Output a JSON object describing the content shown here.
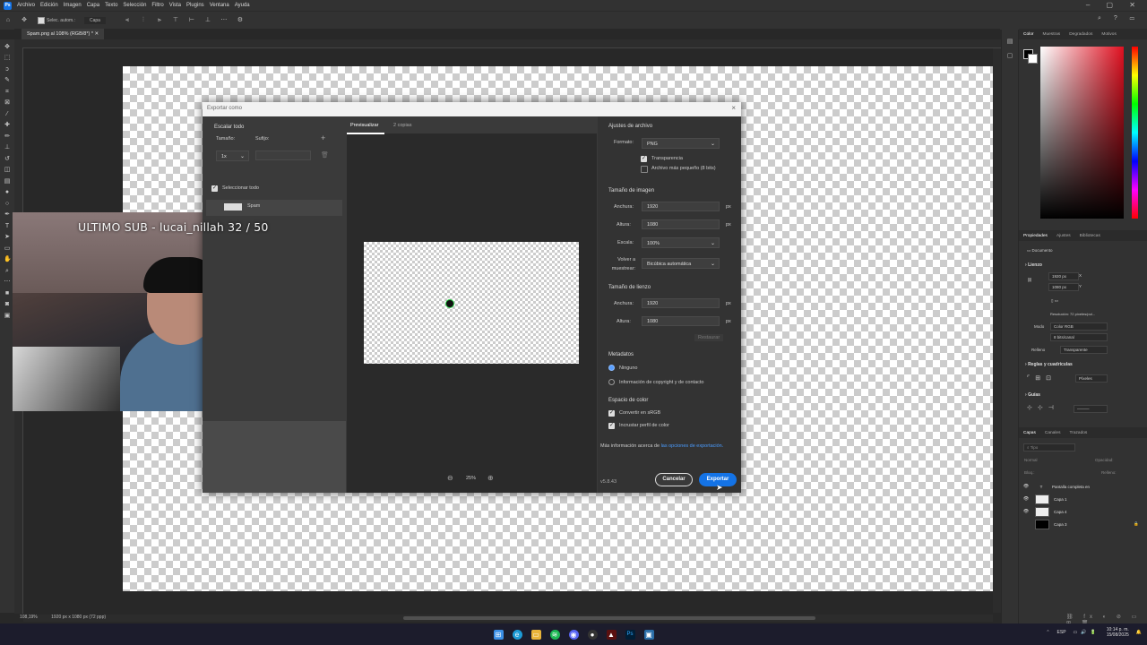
{
  "menu": [
    "Archivo",
    "Edición",
    "Imagen",
    "Capa",
    "Texto",
    "Selección",
    "Filtro",
    "Vista",
    "Plugins",
    "Ventana",
    "Ayuda"
  ],
  "options_bar": {
    "auto_select_label": "Selec. autom.:",
    "layer_select": "Capa"
  },
  "doc_tab": "Spam.png al 108% (RGB/8*) *",
  "status": {
    "zoom": "108,19%",
    "doc_info": "1920 px x 1080 px (72 ppp)"
  },
  "webcam": {
    "overlay_text": "ULTIMO SUB - lucai_nillah   32 / 50"
  },
  "dialog": {
    "title": "Exportar como",
    "left": {
      "scale_all": "Escalar todo",
      "size_label": "Tamaño:",
      "suffix_label": "Sufijo:",
      "scale_value": "1x",
      "select_all": "Seleccionar todo",
      "asset_name": "Spam"
    },
    "center": {
      "tab_preview": "Previsualizar",
      "tab_copies": "2 copias",
      "zoom": "25%"
    },
    "right": {
      "file_settings": "Ajustes de archivo",
      "format_label": "Formato:",
      "format_value": "PNG",
      "transparency": "Transparencia",
      "smaller_file": "Archivo más pequeño (8 bits)",
      "image_size": "Tamaño de imagen",
      "width_label": "Anchura:",
      "width_value": "1920",
      "height_label": "Altura:",
      "height_value": "1080",
      "unit": "px",
      "scale_label": "Escala:",
      "scale_value": "100%",
      "resample_label": "Volver a muestrear:",
      "resample_value": "Bicúbica automática",
      "canvas_size": "Tamaño de lienzo",
      "canvas_width": "1920",
      "canvas_height": "1080",
      "reset": "Restaurar",
      "metadata": "Metadatos",
      "meta_none": "Ninguno",
      "meta_copyright": "Información de copyright y de contacto",
      "color_space": "Espacio de color",
      "convert_srgb": "Convertir en sRGB",
      "embed_profile": "Incrustar perfil de color",
      "more_info": "Más información acerca de",
      "more_info_link": "las opciones de exportación.",
      "version": "v5.8.43",
      "cancel": "Cancelar",
      "export": "Exportar"
    }
  },
  "right_panel": {
    "color_tabs": [
      "Color",
      "Muestras",
      "Degradados",
      "Motivos"
    ],
    "prop_tabs": [
      "Propiedades",
      "Ajustes",
      "Bibliotecas"
    ],
    "doc_label": "Documento",
    "canvas_head": "Lienzo",
    "w_field": "1920 px",
    "h_field": "1080 px",
    "x_label": "X",
    "y_label": "Y",
    "resolution": "Resolución: 72 píxeles/pul...",
    "mode_label": "Modo",
    "mode_value": "Color RGB",
    "bit_value": "8 bits/canal",
    "fill_label": "Relleno",
    "fill_value": "Transparente",
    "rulers_grid": "Reglas y cuadrículas",
    "units_value": "Píxeles",
    "guides": "Guías",
    "layer_tabs": [
      "Capas",
      "Canales",
      "Trazados"
    ],
    "kind_label": "Tipo",
    "normal_label": "Normal",
    "opacity_label": "Opacidad:",
    "lock_label": "Bloq.:",
    "fill2_label": "Relleno:",
    "layers": [
      "Pantalla completa en",
      "Capa 1",
      "Capa 4",
      "Capa 3"
    ]
  },
  "taskbar": {
    "lang": "ESP",
    "time": "10:14 p. m.",
    "date": "15/08/2025"
  },
  "colors": {
    "accent": "#1473e6",
    "bg": "#282828",
    "panel": "#323232"
  }
}
